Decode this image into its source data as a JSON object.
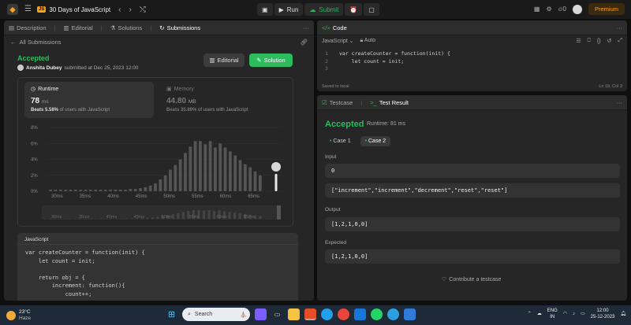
{
  "topbar": {
    "problem_badge": "JS",
    "problem_title": "30 Days of JavaScript",
    "run_label": "Run",
    "submit_label": "Submit",
    "streak_count": "0",
    "premium_label": "Premium"
  },
  "left_panel": {
    "tabs": [
      "Description",
      "Editorial",
      "Solutions",
      "Submissions"
    ],
    "all_submissions": "All Submissions",
    "status": "Accepted",
    "author": "Anshita Dubey",
    "submitted_at": "submitted at Dec 25, 2023 12:00",
    "editorial_btn": "Editorial",
    "solution_btn": "Solution",
    "runtime": {
      "label": "Runtime",
      "value": "78",
      "unit": "ms",
      "beats_pct": "Beats 5.58%",
      "beats_text": "of users with JavaScript"
    },
    "memory": {
      "label": "Memory",
      "value": "44.80",
      "unit": "MB",
      "beats_pct": "Beats 35.89%",
      "beats_text": "of users with JavaScript"
    },
    "code_lang": "JavaScript",
    "code": "var createCounter = function(init) {\n    let count = init;\n\n    return obj = {\n        increment: function(){\n            count++;\n            return count;"
  },
  "chart_data": {
    "type": "bar",
    "ylabel_ticks": [
      "8%",
      "6%",
      "4%",
      "2%",
      "0%"
    ],
    "ylim": [
      0,
      8
    ],
    "x_ticks": [
      "30ms",
      "35ms",
      "40ms",
      "45ms",
      "50ms",
      "55ms",
      "60ms",
      "65ms"
    ],
    "categories": [
      "28",
      "29",
      "30",
      "31",
      "32",
      "33",
      "34",
      "35",
      "36",
      "37",
      "38",
      "39",
      "40",
      "41",
      "42",
      "43",
      "44",
      "45",
      "46",
      "47",
      "48",
      "49",
      "50",
      "51",
      "52",
      "53",
      "54",
      "55",
      "56",
      "57",
      "58",
      "59",
      "60",
      "61",
      "62",
      "63",
      "64",
      "65",
      "66",
      "67",
      "68",
      "69",
      "70"
    ],
    "values": [
      0.2,
      0.2,
      0.2,
      0.2,
      0.2,
      0.2,
      0.2,
      0.2,
      0.2,
      0.2,
      0.2,
      0.2,
      0.2,
      0.2,
      0.2,
      0.2,
      0.3,
      0.3,
      0.4,
      0.5,
      0.7,
      1,
      1.5,
      2,
      2.7,
      3.3,
      4,
      4.8,
      5.6,
      6.3,
      6.3,
      5.9,
      6.3,
      5.5,
      6,
      5.5,
      5,
      4.5,
      3.9,
      3.4,
      3,
      2.5,
      2
    ],
    "highlighted_value": "78ms"
  },
  "code_panel": {
    "title": "Code",
    "language": "JavaScript",
    "auto_label": "Auto",
    "line_numbers": [
      "1",
      "2",
      "3"
    ],
    "lines": [
      "var createCounter = function(init) {",
      "    let count = init;",
      ""
    ],
    "saved": "Saved to local",
    "cursor": "Ln 18, Col 3"
  },
  "result_panel": {
    "tab_testcase": "Testcase",
    "tab_result": "Test Result",
    "status": "Accepted",
    "runtime": "Runtime: 81 ms",
    "case1": "Case 1",
    "case2": "Case 2",
    "input_label": "Input",
    "input_1": "0",
    "input_2": "[\"increment\",\"increment\",\"decrement\",\"reset\",\"reset\"]",
    "output_label": "Output",
    "output": "[1,2,1,0,0]",
    "expected_label": "Expected",
    "expected": "[1,2,1,0,0]",
    "contribute": "Contribute a testcase"
  },
  "taskbar": {
    "temp": "23°C",
    "weather": "Haze",
    "search_placeholder": "Search",
    "lang1": "ENG",
    "lang2": "IN",
    "time": "12:00",
    "date": "25-12-2023"
  },
  "colors": {
    "accent_green": "#2cbb5d",
    "brand_orange": "#ffa116"
  }
}
